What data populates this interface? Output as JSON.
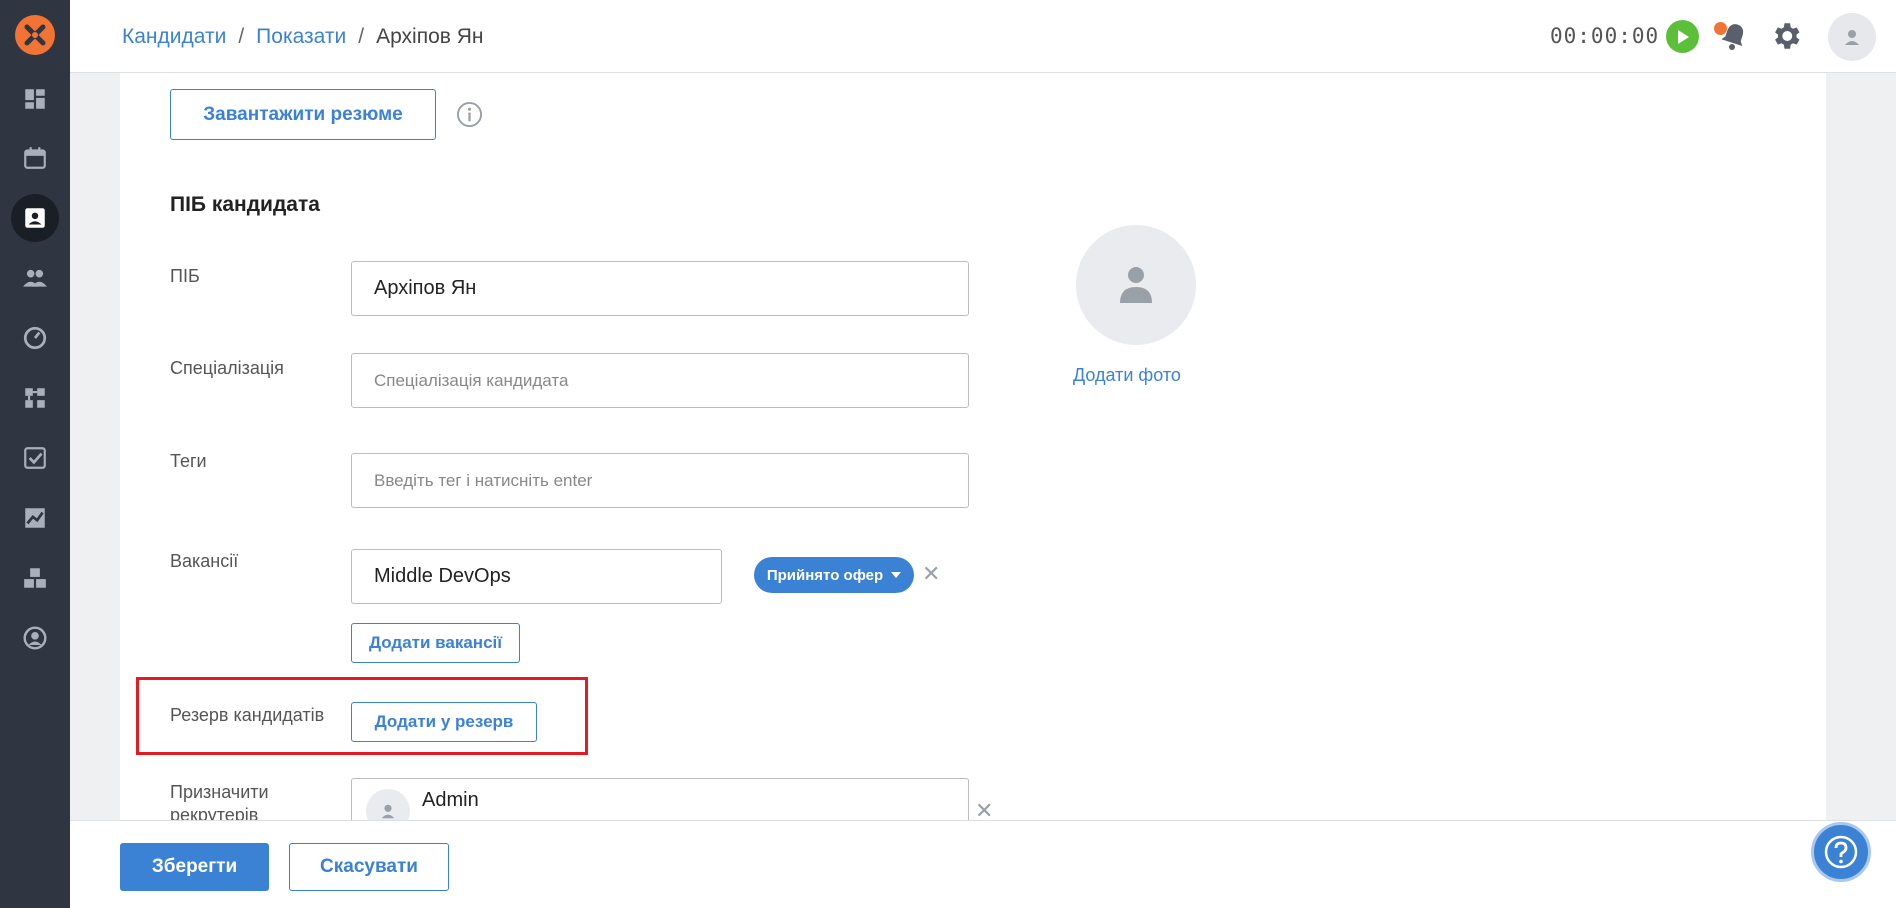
{
  "header": {
    "breadcrumb": [
      {
        "label": "Кандидати"
      },
      {
        "label": "Показати"
      }
    ],
    "breadcrumb_current": "Архіпов Ян",
    "timer": "00:00:00"
  },
  "sidebar": {
    "items": [
      {
        "name": "dashboard-icon"
      },
      {
        "name": "calendar-icon"
      },
      {
        "name": "candidates-icon",
        "active": true
      },
      {
        "name": "clients-icon"
      },
      {
        "name": "speedometer-icon"
      },
      {
        "name": "pipeline-icon"
      },
      {
        "name": "tasks-icon"
      },
      {
        "name": "reports-icon"
      },
      {
        "name": "boxes-icon"
      },
      {
        "name": "account-icon"
      }
    ]
  },
  "form": {
    "upload_label": "Завантажити резюме",
    "section_title": "ПІБ кандидата",
    "name_label": "ПІБ",
    "name_value": "Архіпов Ян",
    "specialization_label": "Спеціалізація",
    "specialization_placeholder": "Спеціалізація кандидата",
    "tags_label": "Теги",
    "tags_placeholder": "Введіть тег і натисніть enter",
    "vacancies_label": "Вакансії",
    "vacancy_value": "Middle DevOps",
    "vacancy_status": "Прийнято офер",
    "add_vacancies_label": "Додати вакансії",
    "reserve_label": "Резерв кандидатів",
    "add_reserve_label": "Додати у резерв",
    "recruiters_label_line1": "Призначити",
    "recruiters_label_line2": "рекрутерів",
    "recruiter_name": "Admin",
    "add_photo_label": "Додати фото"
  },
  "footer": {
    "save_label": "Зберегти",
    "cancel_label": "Скасувати"
  },
  "colors": {
    "accent": "#3c82d4",
    "sidebar": "#2f3541",
    "brand": "#f27434",
    "highlight": "#e31b23"
  }
}
